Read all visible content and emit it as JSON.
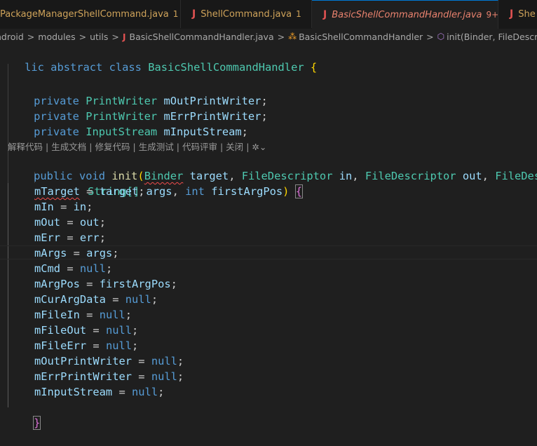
{
  "tabs": [
    {
      "label": "PackageManagerShellCommand.java",
      "count": "1",
      "modified": true
    },
    {
      "label": "ShellCommand.java",
      "count": "1"
    },
    {
      "label": "BasicShellCommandHandler.java",
      "count": "9+",
      "close": "×"
    },
    {
      "label": "She"
    }
  ],
  "breadcrumb": {
    "segments": [
      "ndroid",
      "modules",
      "utils",
      "BasicShellCommandHandler.java",
      "BasicShellCommandHandler",
      "init(Binder, FileDescriptor, F"
    ],
    "separator": ">"
  },
  "code_lens": {
    "items": [
      "解释代码",
      "生成文档",
      "修复代码",
      "生成测试",
      "代码评审",
      "关闭"
    ],
    "separator": "|"
  },
  "code": {
    "class_decl": {
      "pre": "lic",
      "abstract": "abstract",
      "class": "class",
      "name": "BasicShellCommandHandler",
      "open": "{"
    },
    "fields": [
      {
        "mod": "private",
        "type": "PrintWriter",
        "name": "mOutPrintWriter"
      },
      {
        "mod": "private",
        "type": "PrintWriter",
        "name": "mErrPrintWriter"
      },
      {
        "mod": "private",
        "type": "InputStream",
        "name": "mInputStream"
      }
    ],
    "method": {
      "mod": "public",
      "ret": "void",
      "name": "init",
      "p1_type": "Binder",
      "p1_name": "target",
      "p2_type": "FileDescriptor",
      "p2_name": "in",
      "p3_type": "FileDescriptor",
      "p3_name": "out",
      "p4_type": "FileDesc",
      "p5_type": "String[]",
      "p5_name": "args",
      "p6_type": "int",
      "p6_name": "firstArgPos",
      "open": "{"
    },
    "assignments": [
      {
        "lhs": "mTarget",
        "rhs": "target",
        "rhs_kind": "var"
      },
      {
        "lhs": "mIn",
        "rhs": "in",
        "rhs_kind": "var"
      },
      {
        "lhs": "mOut",
        "rhs": "out",
        "rhs_kind": "var"
      },
      {
        "lhs": "mErr",
        "rhs": "err",
        "rhs_kind": "var"
      },
      {
        "lhs": "mArgs",
        "rhs": "args",
        "rhs_kind": "var"
      },
      {
        "lhs": "mCmd",
        "rhs": "null",
        "rhs_kind": "kw"
      },
      {
        "lhs": "mArgPos",
        "rhs": "firstArgPos",
        "rhs_kind": "var"
      },
      {
        "lhs": "mCurArgData",
        "rhs": "null",
        "rhs_kind": "kw"
      },
      {
        "lhs": "mFileIn",
        "rhs": "null",
        "rhs_kind": "kw"
      },
      {
        "lhs": "mFileOut",
        "rhs": "null",
        "rhs_kind": "kw"
      },
      {
        "lhs": "mFileErr",
        "rhs": "null",
        "rhs_kind": "kw"
      },
      {
        "lhs": "mOutPrintWriter",
        "rhs": "null",
        "rhs_kind": "kw"
      },
      {
        "lhs": "mErrPrintWriter",
        "rhs": "null",
        "rhs_kind": "kw"
      },
      {
        "lhs": "mInputStream",
        "rhs": "null",
        "rhs_kind": "kw"
      }
    ],
    "close": "}"
  },
  "colors": {
    "background": "#1f1f1f",
    "keyword": "#569cd6",
    "type": "#4ec9b0",
    "variable": "#9cdcfe",
    "function": "#dcdcaa",
    "active_tab_text": "#e9826e",
    "modified_tab_text": "#cfa35a",
    "java_icon": "#e05252"
  },
  "icons": {
    "java_file": "java-file-icon",
    "class": "class-icon",
    "method": "method-icon",
    "lens_logo": "ai-assistant-icon",
    "close": "close-icon"
  }
}
